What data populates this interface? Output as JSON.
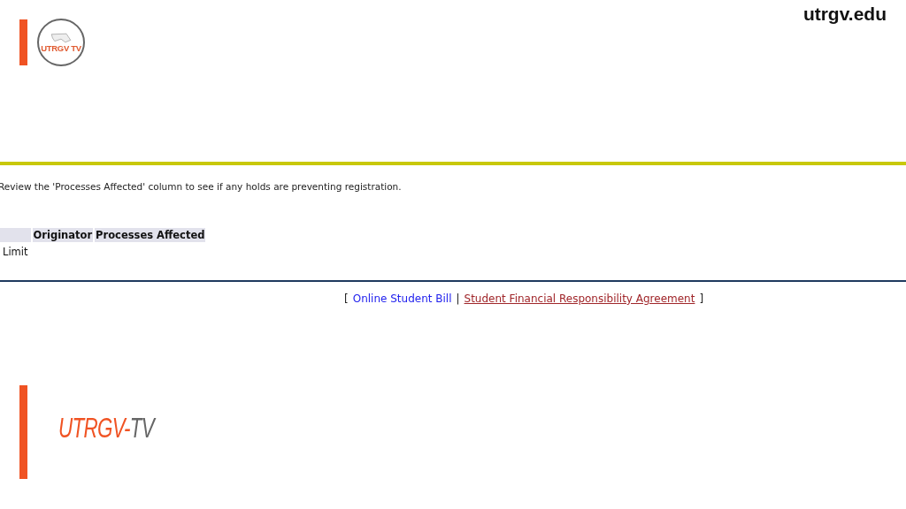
{
  "overlay": {
    "badge_text": "UTRGV TV",
    "site": "utrgv.edu",
    "brand_main": "UTRGV-",
    "brand_tail": "TV"
  },
  "page": {
    "instruction": "Review the 'Processes Affected' column to see if any holds are preventing registration.",
    "table": {
      "columns": [
        "",
        "Originator",
        "Processes Affected"
      ],
      "rows": [
        [
          "Limit",
          "",
          ""
        ]
      ]
    },
    "links": [
      {
        "label": "Online Student Bill",
        "hovered": false
      },
      {
        "label": "Student Financial Responsibility Agreement",
        "hovered": true
      }
    ],
    "bracket_open": "[",
    "separator": "|",
    "bracket_close": "]"
  }
}
